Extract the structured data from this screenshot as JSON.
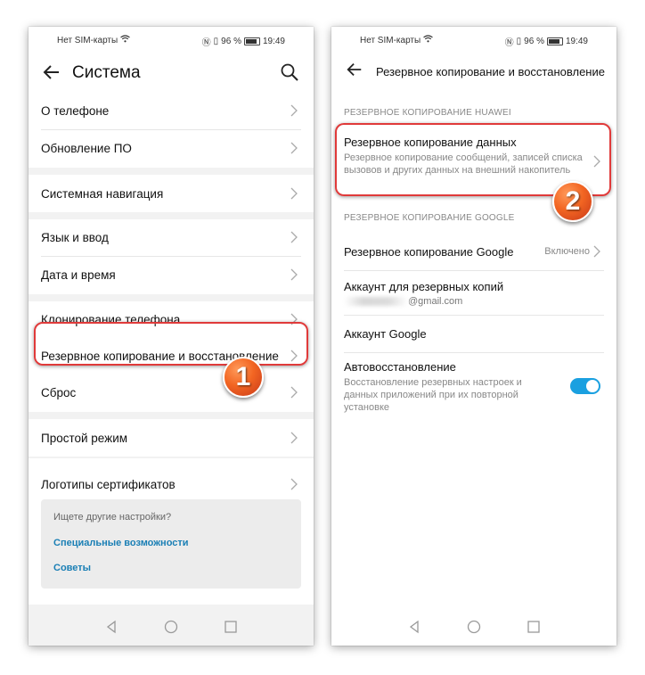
{
  "status_bar": {
    "carrier": "Нет SIM-карты",
    "battery_percent": "96 %",
    "time": "19:49"
  },
  "left_screen": {
    "title": "Система",
    "groups": [
      {
        "items": [
          "О телефоне",
          "Обновление ПО"
        ]
      },
      {
        "items": [
          "Системная навигация"
        ]
      },
      {
        "items": [
          "Язык и ввод",
          "Дата и время"
        ]
      },
      {
        "items": [
          "Клонирование телефона",
          "Резервное копирование и восстановление",
          "Сброс"
        ]
      },
      {
        "items": [
          "Простой режим"
        ]
      },
      {
        "items": [
          "Логотипы сертификатов"
        ]
      }
    ],
    "suggestions": {
      "question": "Ищете другие настройки?",
      "links": [
        "Специальные возможности",
        "Советы"
      ]
    },
    "badge": "1"
  },
  "right_screen": {
    "title": "Резервное копирование и восстановление",
    "huawei_section": "РЕЗЕРВНОЕ КОПИРОВАНИЕ HUAWEI",
    "data_backup": {
      "title": "Резервное копирование данных",
      "subtitle": "Резервное копирование сообщений, записей списка вызовов и других данных на внешний накопитель"
    },
    "google_section": "РЕЗЕРВНОЕ КОПИРОВАНИЕ GOOGLE",
    "google_backup": {
      "title": "Резервное копирование Google",
      "value": "Включено"
    },
    "backup_account": {
      "title": "Аккаунт для резервных копий",
      "email_suffix": "@gmail.com"
    },
    "google_account": {
      "title": "Аккаунт Google"
    },
    "auto_restore": {
      "title": "Автовосстановление",
      "subtitle": "Восстановление резервных настроек и данных приложений при их повторной установке",
      "enabled": true
    },
    "badge": "2"
  },
  "colors": {
    "accent": "#1a7fb5",
    "toggle_on": "#1aa0e0",
    "highlight": "#e03a3a",
    "badge": "#f26522"
  }
}
